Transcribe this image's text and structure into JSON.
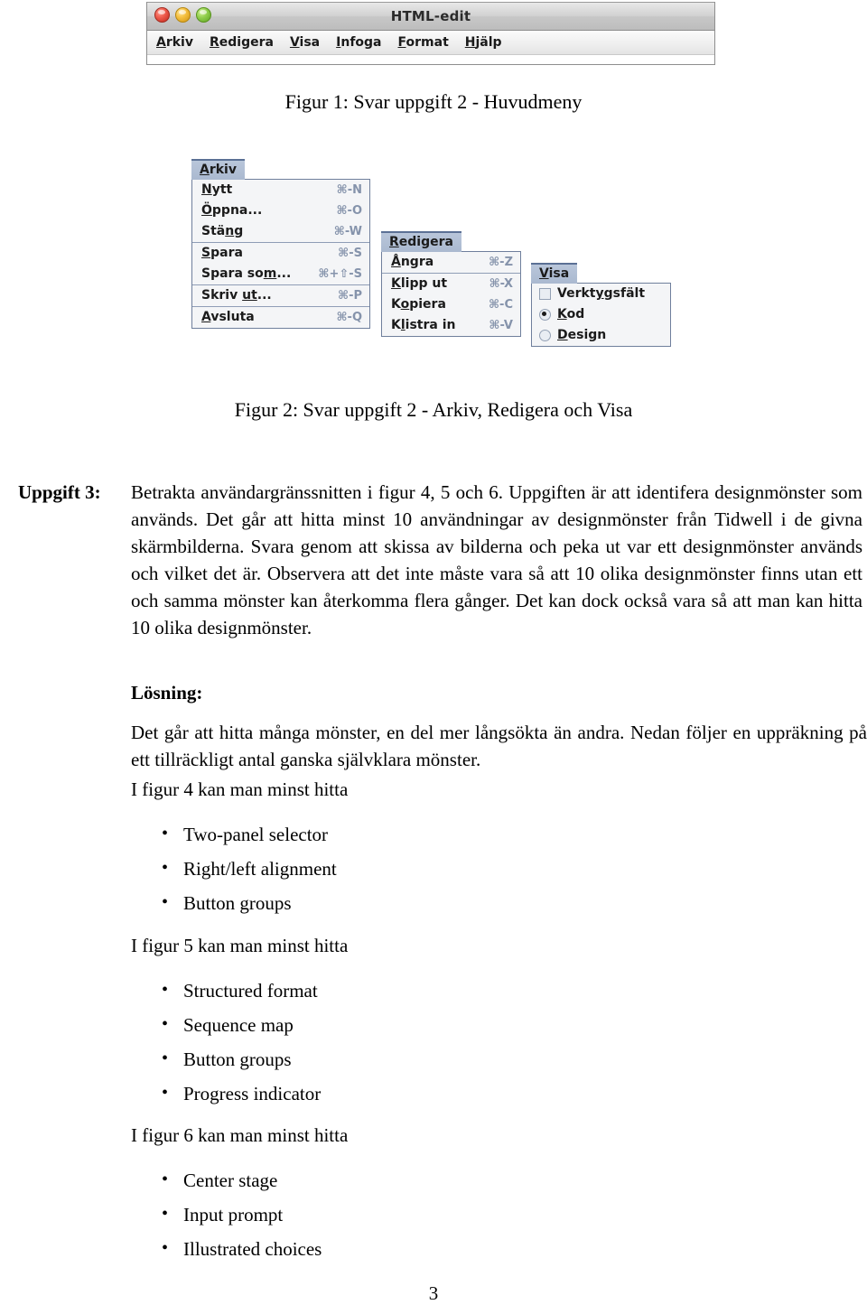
{
  "figure1": {
    "window": {
      "title": "HTML-edit",
      "traffic_lights": [
        "close",
        "minimize",
        "zoom"
      ],
      "menubar": [
        {
          "mnemonic": "A",
          "rest": "rkiv"
        },
        {
          "mnemonic": "R",
          "rest": "edigera"
        },
        {
          "mnemonic": "V",
          "rest": "isa"
        },
        {
          "mnemonic": "I",
          "rest": "nfoga"
        },
        {
          "mnemonic": "F",
          "rest": "ormat"
        },
        {
          "mnemonic": "H",
          "rest": "jälp"
        }
      ]
    },
    "caption": "Figur 1: Svar uppgift 2 - Huvudmeny"
  },
  "figure2": {
    "caption": "Figur 2: Svar uppgift 2 - Arkiv, Redigera och Visa",
    "menus": [
      {
        "name": "arkiv",
        "title": {
          "mnemonic": "A",
          "rest": "rkiv"
        },
        "groups": [
          [
            {
              "pre": "",
              "mnemonic": "N",
              "post": "ytt",
              "accel": "⌘-N"
            },
            {
              "pre": "",
              "mnemonic": "Ö",
              "post": "ppna...",
              "accel": "⌘-O"
            },
            {
              "pre": "Stä",
              "mnemonic": "n",
              "post": "g",
              "accel": "⌘-W"
            }
          ],
          [
            {
              "pre": "",
              "mnemonic": "S",
              "post": "para",
              "accel": "⌘-S"
            },
            {
              "pre": "Spara so",
              "mnemonic": "m",
              "post": "...",
              "accel": "⌘+⇧-S"
            }
          ],
          [
            {
              "pre": "Skriv ",
              "mnemonic": "ut",
              "post": "...",
              "accel": "⌘-P"
            }
          ],
          [
            {
              "pre": "",
              "mnemonic": "A",
              "post": "vsluta",
              "accel": "⌘-Q"
            }
          ]
        ]
      },
      {
        "name": "redigera",
        "title": {
          "mnemonic": "R",
          "rest": "edigera"
        },
        "groups": [
          [
            {
              "pre": "",
              "mnemonic": "Å",
              "post": "ngra",
              "accel": "⌘-Z"
            }
          ],
          [
            {
              "pre": "",
              "mnemonic": "K",
              "post": "lipp ut",
              "accel": "⌘-X"
            },
            {
              "pre": "K",
              "mnemonic": "o",
              "post": "piera",
              "accel": "⌘-C"
            },
            {
              "pre": "K",
              "mnemonic": "l",
              "post": "istra in",
              "accel": "⌘-V"
            }
          ]
        ]
      },
      {
        "name": "visa",
        "title": {
          "mnemonic": "V",
          "rest": "isa"
        },
        "options": [
          {
            "widget": "checkbox",
            "checked": false,
            "pre": "Verkt",
            "mnemonic": "y",
            "post": "gsfält"
          },
          {
            "widget": "radio",
            "checked": true,
            "pre": "",
            "mnemonic": "K",
            "post": "od"
          },
          {
            "widget": "radio",
            "checked": false,
            "pre": "",
            "mnemonic": "D",
            "post": "esign"
          }
        ]
      }
    ]
  },
  "task": {
    "label": "Uppgift 3:",
    "body": "Betrakta användargränssnitten i figur 4, 5 och 6. Uppgiften är att identifera designmönster som används. Det går att hitta minst 10 användningar av designmönster från Tidwell i de givna skärmbilderna. Svara genom att skissa av bilderna och peka ut var ett designmönster används och vilket det är. Observera att det inte måste vara så att 10 olika designmönster finns utan ett och samma mönster kan återkomma flera gånger. Det kan dock också vara så att man kan hitta 10 olika designmönster."
  },
  "solution": {
    "title": "Lösning:",
    "paragraph": "Det går att hitta många mönster, en del mer långsökta än andra. Nedan följer en uppräkning på ett tillräckligt antal ganska självklara mönster.",
    "intro_fig4": "I figur 4 kan man minst hitta",
    "bullets_fig4": [
      "Two-panel selector",
      "Right/left alignment",
      "Button groups"
    ],
    "intro_fig5": "I figur 5 kan man minst hitta",
    "bullets_fig5": [
      "Structured format",
      "Sequence map",
      "Button groups",
      "Progress indicator"
    ],
    "intro_fig6": "I figur 6 kan man minst hitta",
    "bullets_fig6": [
      "Center stage",
      "Input prompt",
      "Illustrated choices"
    ]
  },
  "page_number": "3"
}
